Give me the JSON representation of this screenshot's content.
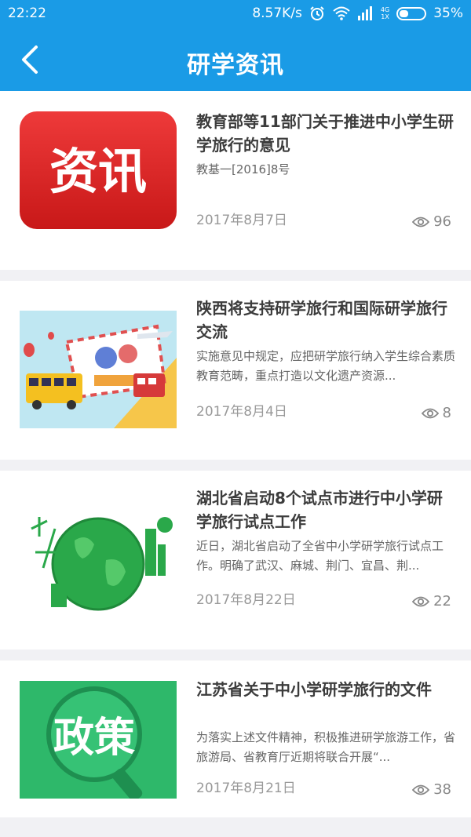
{
  "status": {
    "time": "22:22",
    "speed": "8.57K/s",
    "net_top": "4G",
    "net_bottom": "1X",
    "battery": "35%"
  },
  "header": {
    "title": "研学资讯"
  },
  "articles": [
    {
      "title": "教育部等11部门关于推进中小学生研学旅行的意见",
      "summary": "教基一[2016]8号",
      "date": "2017年8月7日",
      "views": "96",
      "thumb_text": "资讯",
      "thumb_color": "#e02b2b"
    },
    {
      "title": "陕西将支持研学旅行和国际研学旅行交流",
      "summary": "实施意见中规定，应把研学旅行纳入学生综合素质教育范畴，重点打造以文化遗产资源...",
      "date": "2017年8月4日",
      "views": "8"
    },
    {
      "title": "湖北省启动8个试点市进行中小学研学旅行试点工作",
      "summary": "近日，湖北省启动了全省中小学研学旅行试点工作。明确了武汉、麻城、荆门、宜昌、荆...",
      "date": "2017年8月22日",
      "views": "22"
    },
    {
      "title": "江苏省关于中小学研学旅行的文件",
      "summary": "为落实上述文件精神，积极推进研学旅游工作，省旅游局、省教育厅近期将联合开展“...",
      "date": "2017年8月21日",
      "views": "38",
      "thumb_text": "政策",
      "thumb_color": "#2eb86a"
    }
  ]
}
